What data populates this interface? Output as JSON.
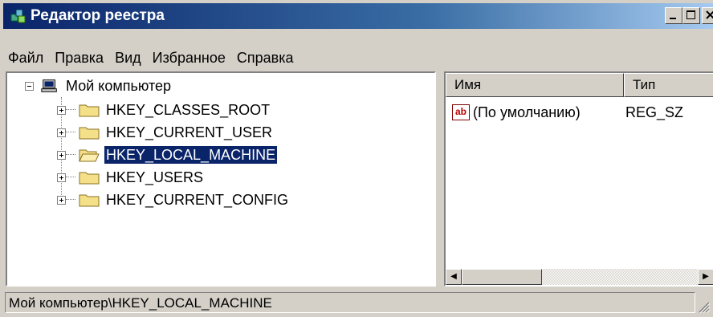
{
  "window": {
    "title": "Редактор реестра"
  },
  "menu": [
    "Файл",
    "Правка",
    "Вид",
    "Избранное",
    "Справка"
  ],
  "tree": {
    "root": "Мой компьютер",
    "keys": [
      "HKEY_CLASSES_ROOT",
      "HKEY_CURRENT_USER",
      "HKEY_LOCAL_MACHINE",
      "HKEY_USERS",
      "HKEY_CURRENT_CONFIG"
    ],
    "selected": "HKEY_LOCAL_MACHINE"
  },
  "list": {
    "columns": [
      "Имя",
      "Тип"
    ],
    "rows": [
      {
        "name": "(По умолчанию)",
        "type": "REG_SZ",
        "icon": "string-value-icon"
      }
    ]
  },
  "status": {
    "path": "Мой компьютер\\HKEY_LOCAL_MACHINE"
  },
  "colors": {
    "title_start": "#0a246a",
    "title_end": "#a6caf0",
    "selection": "#0a246a",
    "face": "#d4d0c8"
  }
}
